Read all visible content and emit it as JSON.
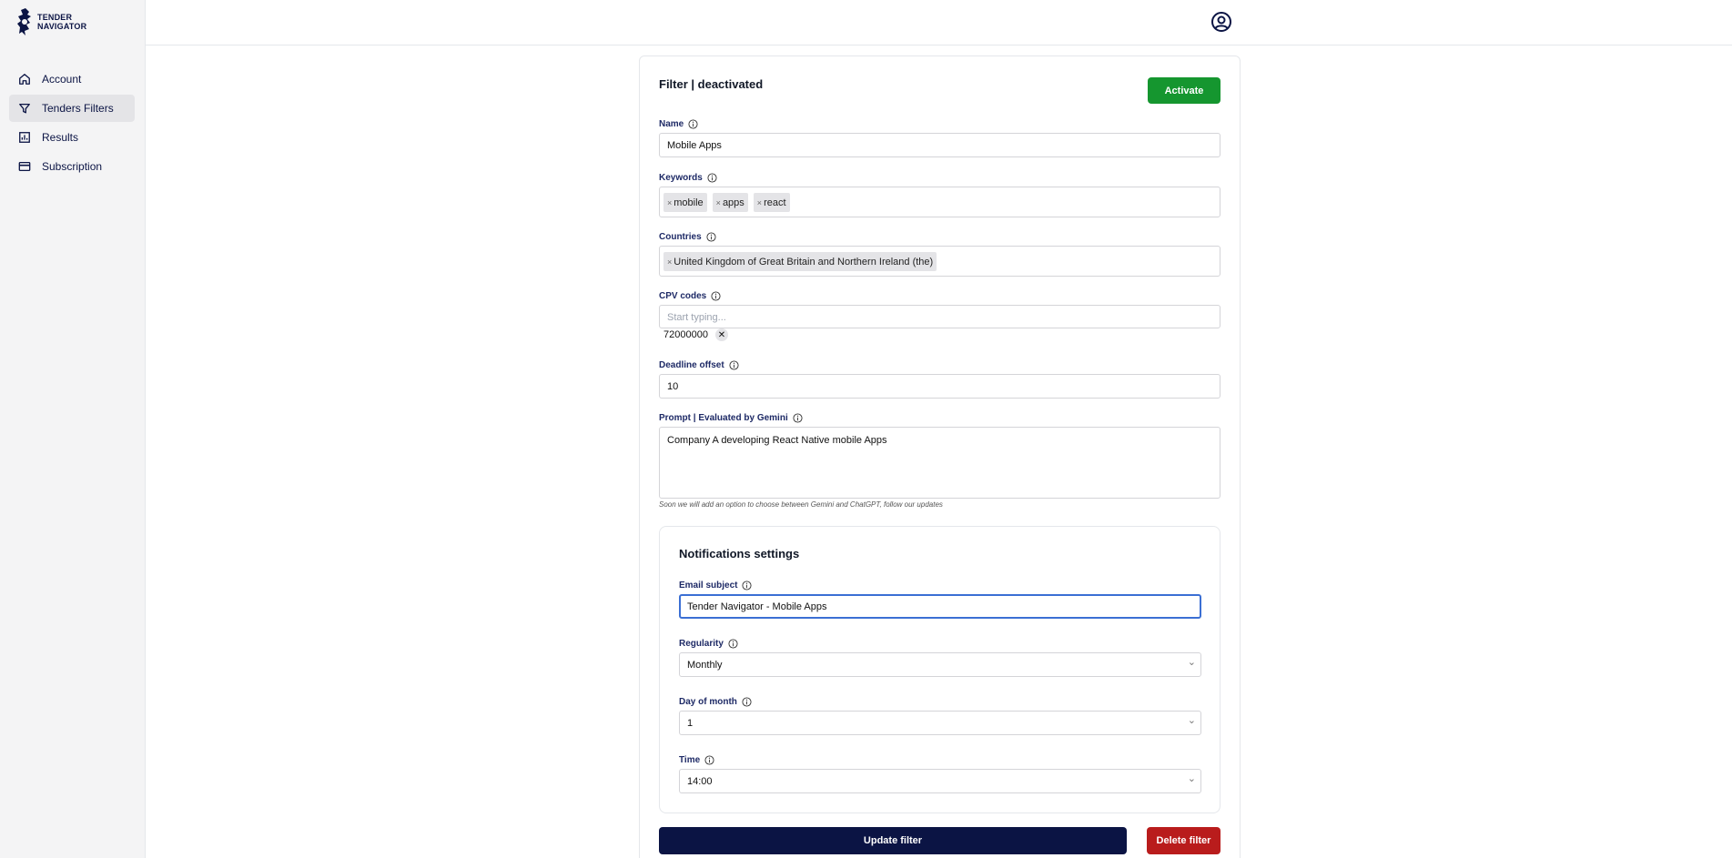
{
  "app": {
    "logo_line1": "TENDER",
    "logo_line2": "NAVIGATOR"
  },
  "sidebar": {
    "items": [
      {
        "label": "Account",
        "icon": "home-icon"
      },
      {
        "label": "Tenders Filters",
        "icon": "filter-icon",
        "active": true
      },
      {
        "label": "Results",
        "icon": "chart-icon"
      },
      {
        "label": "Subscription",
        "icon": "credit-card-icon"
      }
    ]
  },
  "header": {
    "user_icon": "user-circle-icon"
  },
  "filter": {
    "title": "Filter | deactivated",
    "activate_label": "Activate",
    "name": {
      "label": "Name",
      "value": "Mobile Apps"
    },
    "keywords": {
      "label": "Keywords",
      "tags": [
        "mobile",
        "apps",
        "react"
      ]
    },
    "countries": {
      "label": "Countries",
      "tags": [
        "United Kingdom of Great Britain and Northern Ireland (the)"
      ]
    },
    "cpv": {
      "label": "CPV codes",
      "placeholder": "Start typing...",
      "codes": [
        "72000000"
      ]
    },
    "deadline": {
      "label": "Deadline offset",
      "value": "10"
    },
    "prompt": {
      "label": "Prompt | Evaluated by Gemini",
      "value": "Company A developing React Native mobile Apps",
      "hint": "Soon we will add an option to choose between Gemini and ChatGPT, follow our updates"
    },
    "notifications": {
      "title": "Notifications settings",
      "email_subject": {
        "label": "Email subject",
        "value": "Tender Navigator - Mobile Apps"
      },
      "regularity": {
        "label": "Regularity",
        "value": "Monthly"
      },
      "day_of_month": {
        "label": "Day of month",
        "value": "1"
      },
      "time": {
        "label": "Time",
        "value": "14:00"
      }
    },
    "update_label": "Update filter",
    "delete_label": "Delete filter"
  },
  "colors": {
    "primary": "#0b1444",
    "activate": "#15962f",
    "delete": "#b91c1c",
    "focus": "#3b6fd4"
  }
}
